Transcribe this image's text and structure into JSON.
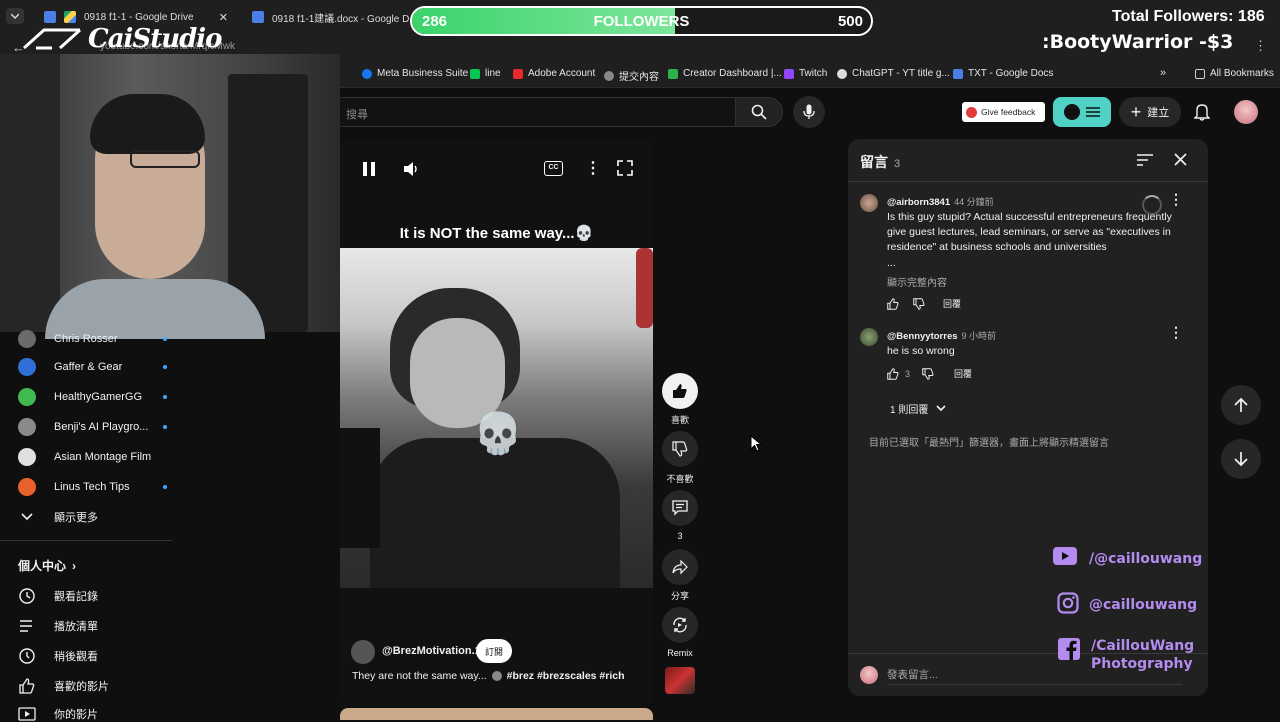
{
  "browser": {
    "tabs": [
      {
        "label": "0918 f1-1 - Google Drive"
      },
      {
        "label": "0918 f1-1建議.docx - Google D"
      }
    ],
    "url": "youtube.com/shorts/MrqlcMwk",
    "bookmarks": [
      {
        "label": "Meta Business Suite"
      },
      {
        "label": "line"
      },
      {
        "label": "Adobe Account"
      },
      {
        "label": "提交內容"
      },
      {
        "label": "Creator Dashboard |..."
      },
      {
        "label": "Twitch"
      },
      {
        "label": "ChatGPT - YT title g..."
      },
      {
        "label": "TXT - Google Docs"
      }
    ],
    "all_bookmarks": "All Bookmarks"
  },
  "overlay": {
    "followers_current": "286",
    "followers_label": "FOLLOWERS",
    "followers_goal": "500",
    "followers_progress": 0.572,
    "total_followers": "Total Followers: 186",
    "donation": ":BootyWarrior -$3",
    "logo": "CaiStudio",
    "socials": [
      {
        "icon": "youtube-icon",
        "label": "/@caillouwang"
      },
      {
        "icon": "instagram-icon",
        "label": "@caillouwang"
      },
      {
        "icon": "facebook-icon",
        "label": "/CaillouWang",
        "label2": "Photography"
      }
    ]
  },
  "header": {
    "search_placeholder": "搜尋",
    "feedback": "Give feedback",
    "create": "建立"
  },
  "sidebar": {
    "subscriptions": [
      {
        "label": "Chris Rosser",
        "color": "#6b6b6b"
      },
      {
        "label": "Gaffer & Gear",
        "color": "#2f6fd6"
      },
      {
        "label": "HealthyGamerGG",
        "color": "#3fb950"
      },
      {
        "label": "Benji's AI Playgro...",
        "color": "#8a8a8a"
      },
      {
        "label": "Asian Montage Film",
        "color": "#e0e0e0"
      },
      {
        "label": "Linus Tech Tips",
        "color": "#e8602a"
      }
    ],
    "show_more": "顯示更多",
    "you_section": "個人中心",
    "you_items": [
      {
        "icon": "history-icon",
        "label": "觀看記錄"
      },
      {
        "icon": "playlist-icon",
        "label": "播放清單"
      },
      {
        "icon": "watch-later-icon",
        "label": "稍後觀看"
      },
      {
        "icon": "liked-videos-icon",
        "label": "喜歡的影片"
      },
      {
        "icon": "your-videos-icon",
        "label": "你的影片"
      }
    ]
  },
  "video": {
    "caption": "It is NOT the same way...💀",
    "channel": "@BrezMotivation.1",
    "subscribe": "訂閱",
    "description": "They are not the same way...",
    "hashtags": "#brez #brezscales #rich",
    "actions": {
      "like": "喜歡",
      "dislike": "不喜歡",
      "comments_count": "3",
      "share": "分享",
      "remix": "Remix"
    }
  },
  "comments": {
    "title": "留言",
    "count": "3",
    "items": [
      {
        "author": "@airborn3841",
        "time": "44 分鐘前",
        "text": "Is this guy stupid? Actual successful entrepreneurs frequently give guest lectures, lead seminars, or serve as \"executives in residence\" at business schools and universities",
        "ellipsis": "...",
        "read_more": "顯示完整內容",
        "reply": "回覆",
        "likes": ""
      },
      {
        "author": "@Bennyytorres",
        "time": "9 小時前",
        "text": "he is so wrong",
        "reply": "回覆",
        "likes": "3",
        "replies": "1 則回覆"
      }
    ],
    "filter_note": "目前已選取「最熱門」篩選器，畫面上將顯示精選留言",
    "add_placeholder": "發表留言..."
  }
}
